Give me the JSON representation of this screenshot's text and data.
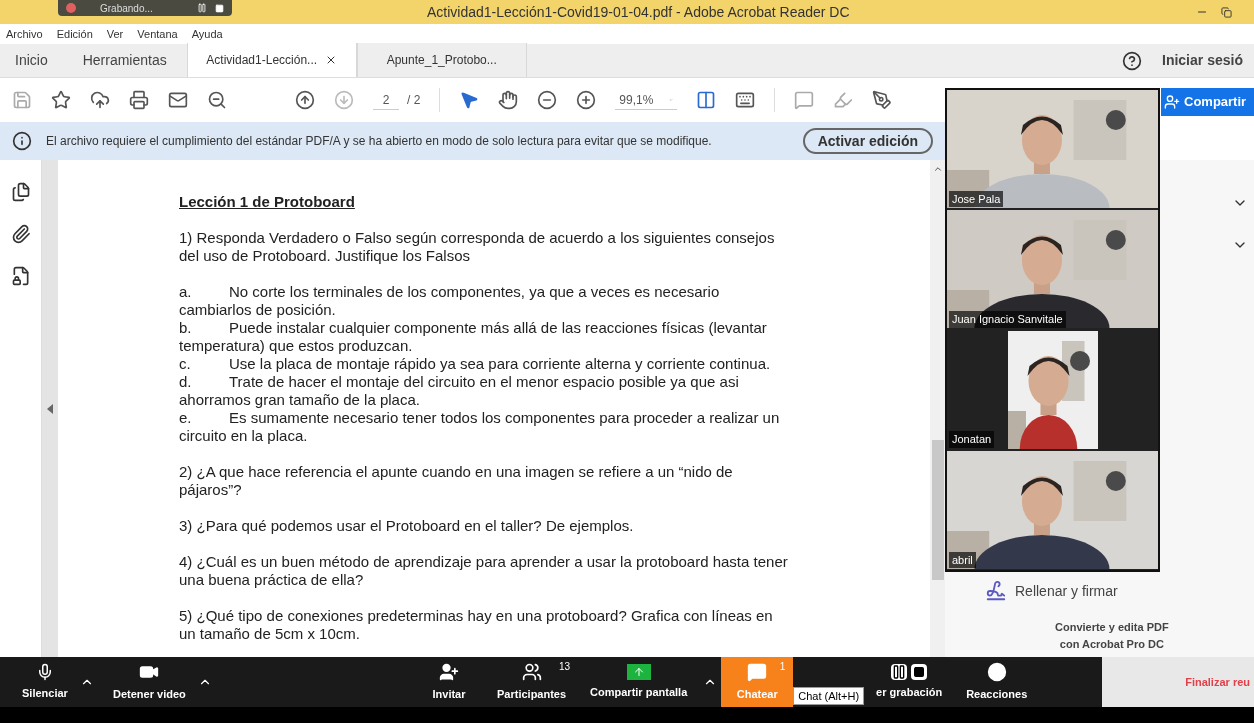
{
  "recording": {
    "label": "Grabando..."
  },
  "window": {
    "title": "Actividad1-Lección1-Covid19-01-04.pdf - Adobe Acrobat Reader DC"
  },
  "menu": [
    "Archivo",
    "Edición",
    "Ver",
    "Ventana",
    "Ayuda"
  ],
  "nav": [
    {
      "label": "Inicio"
    },
    {
      "label": "Herramientas"
    }
  ],
  "tabs": [
    {
      "label": "Actividad1-Lección...",
      "selected": true
    },
    {
      "label": "Apunte_1_Protobo...",
      "selected": false
    }
  ],
  "sign_in": "Iniciar sesió",
  "toolbar": {
    "page_current": "2",
    "page_total": "/ 2",
    "zoom": "99,1%"
  },
  "share_button": "Compartir",
  "notice": {
    "message": "El archivo requiere el cumplimiento del estándar PDF/A y se ha abierto en modo de solo lectura para evitar que se modifique.",
    "button": "Activar edición"
  },
  "document": {
    "title": "Lección 1 de Protoboard",
    "blocks": [
      {
        "kind": "para",
        "text": "1)  Responda Verdadero  o Falso según corresponda de acuerdo a los siguientes consejos del uso de Protoboard. Justifique los Falsos"
      },
      {
        "kind": "list",
        "items": [
          {
            "label": "a.",
            "text": "No corte los terminales de los componentes, ya que a veces es necesario cambiarlos de posición."
          },
          {
            "label": "b.",
            "text": "Puede instalar cualquier componente más allá de las reacciones físicas (levantar temperatura)  que estos produzcan."
          },
          {
            "label": "c.",
            "text": "Use la placa de montaje rápido ya sea para corriente alterna y corriente continua."
          },
          {
            "label": "d.",
            "text": "Trate de hacer el montaje del circuito en el menor espacio posible ya que asi ahorramos gran tamaño de la placa."
          },
          {
            "label": "e.",
            "text": "Es sumamente necesario tener todos los componentes para proceder a realizar un circuito en la placa."
          }
        ]
      },
      {
        "kind": "para",
        "text": "2) ¿A que hace referencia el apunte cuando en una imagen se refiere a un “nido de pájaros”?"
      },
      {
        "kind": "para",
        "text": "3) ¿Para qué podemos usar el Protoboard en el taller? De ejemplos."
      },
      {
        "kind": "para",
        "text": "4) ¿Cuál es un buen método de aprendizaje para aprender a usar la protoboard hasta tener una buena práctica de ella?"
      },
      {
        "kind": "para",
        "text": "5) ¿Qué tipo de conexiones predeterminas hay en una protoboard? Grafica con líneas en un tamaño de 5cm x 10cm."
      }
    ]
  },
  "right_pane": {
    "fill_sign": "Rellenar y firmar",
    "promo": [
      "Convierte y edita PDF",
      "con Acrobat Pro DC"
    ]
  },
  "participants": [
    {
      "name": "Jose Pala",
      "kind": "wide"
    },
    {
      "name": "Juan Ignacio Sanvitale",
      "kind": "wide"
    },
    {
      "name": "Jonatan",
      "kind": "narrow"
    },
    {
      "name": "abril",
      "kind": "wide"
    }
  ],
  "meeting_bar": {
    "left": [
      {
        "label": "Silenciar",
        "kind": "mic"
      },
      {
        "label": "Detener video",
        "kind": "video"
      }
    ],
    "center": [
      {
        "label": "Invitar",
        "kind": "invite",
        "active": false
      },
      {
        "label": "Participantes",
        "kind": "participants",
        "count": "13",
        "active": false
      },
      {
        "label": "Compartir pantalla",
        "kind": "share",
        "active": false
      },
      {
        "label": "Chatear",
        "kind": "chat",
        "count": "1",
        "active": true
      },
      {
        "label": "er grabación",
        "kind": "record",
        "active": false
      },
      {
        "label": "Reacciones",
        "kind": "reactions",
        "active": false
      }
    ],
    "tooltip": "Chat (Alt+H)",
    "end": "Finalizar reu"
  }
}
